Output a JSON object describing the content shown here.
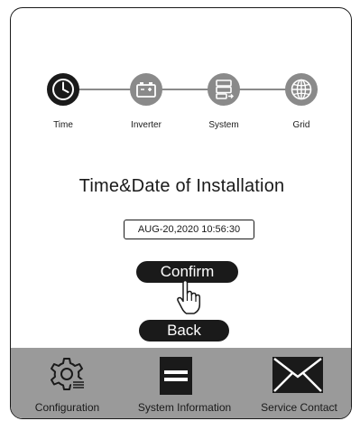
{
  "steps": [
    {
      "label": "Time",
      "icon": "clock-icon",
      "state": "active"
    },
    {
      "label": "Inverter",
      "icon": "battery-icon",
      "state": "inactive"
    },
    {
      "label": "System",
      "icon": "server-icon",
      "state": "inactive"
    },
    {
      "label": "Grid",
      "icon": "globe-icon",
      "state": "inactive"
    }
  ],
  "main": {
    "title": "Time&Date of Installation",
    "datetime_value": "AUG-20,2020 10:56:30",
    "confirm_label": "Confirm",
    "back_label": "Back"
  },
  "bottom_nav": {
    "items": [
      {
        "label": "Configuration",
        "icon": "gear-icon"
      },
      {
        "label": "System Information",
        "icon": "document-icon"
      },
      {
        "label": "Service Contact",
        "icon": "envelope-icon"
      }
    ]
  },
  "colors": {
    "active_step": "#1a1a1a",
    "inactive_step": "#8a8a8a",
    "bottom_bar": "#9a9a9a",
    "button": "#1a1a1a"
  }
}
